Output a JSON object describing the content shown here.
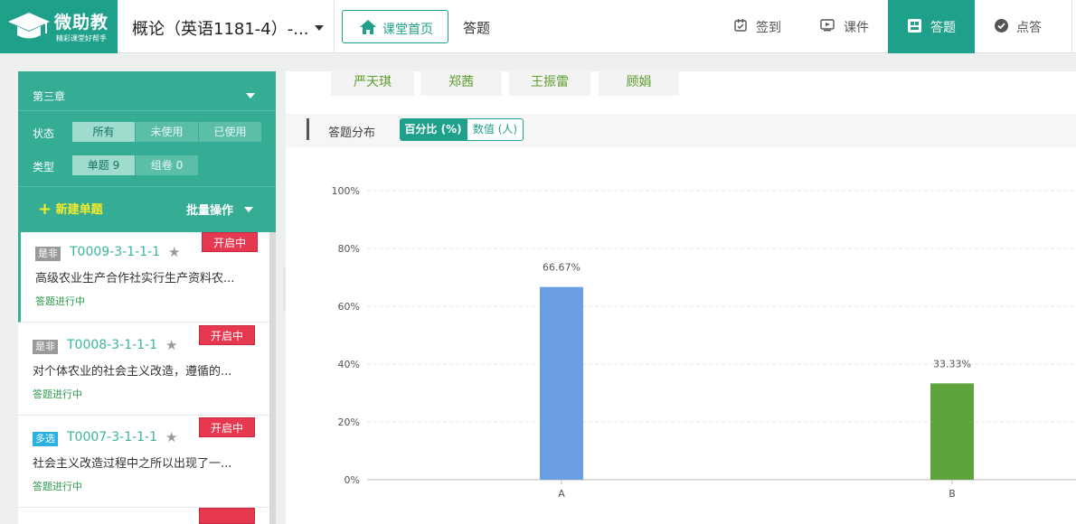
{
  "app": {
    "logo_title": "微助教",
    "logo_subtitle": "精彩课堂好帮手"
  },
  "header": {
    "course_title": "概论（英语1181-4）-...",
    "home_button": "课堂首页",
    "breadcrumb": "答题",
    "nav": [
      {
        "label": "签到",
        "icon": "checkin-icon"
      },
      {
        "label": "课件",
        "icon": "slides-icon"
      },
      {
        "label": "答题",
        "icon": "answer-icon",
        "active": true
      },
      {
        "label": "点答",
        "icon": "check-circle-icon"
      }
    ]
  },
  "sidebar": {
    "chapter": "第三章",
    "status_label": "状态",
    "status_options": [
      "所有",
      "未使用",
      "已使用"
    ],
    "status_selected": "所有",
    "type_label": "类型",
    "type_options": [
      "单题 9",
      "组卷 0"
    ],
    "type_selected": "单题 9",
    "new_question": "新建单题",
    "batch_ops": "批量操作",
    "questions": [
      {
        "tag": "是非",
        "code": "T0009-3-1-1-1",
        "badge": "开启中",
        "text": "高级农业生产合作社实行生产资料农...",
        "status": "答题进行中",
        "active": true
      },
      {
        "tag": "是非",
        "code": "T0008-3-1-1-1",
        "badge": "开启中",
        "text": "对个体农业的社会主义改造，遵循的...",
        "status": "答题进行中",
        "active": false
      },
      {
        "tag": "多选",
        "code": "T0007-3-1-1-1",
        "badge": "开启中",
        "text": "社会主义改造过程中之所以出现了一...",
        "status": "答题进行中",
        "active": false
      }
    ]
  },
  "main": {
    "students": [
      "严天琪",
      "郑茜",
      "王振雷",
      "顾娟"
    ],
    "distribution_label": "答题分布",
    "toggle_percent": "百分比 (%)",
    "toggle_count": "数值 (人)"
  },
  "chart_data": {
    "type": "bar",
    "categories": [
      "A",
      "B"
    ],
    "values": [
      66.67,
      33.33
    ],
    "value_labels": [
      "66.67%",
      "33.33%"
    ],
    "colors": [
      "#6a9fe4",
      "#5fa33d"
    ],
    "ylim": [
      0,
      100
    ],
    "yticks": [
      "0%",
      "20%",
      "40%",
      "60%",
      "80%",
      "100%"
    ],
    "grid": true
  }
}
